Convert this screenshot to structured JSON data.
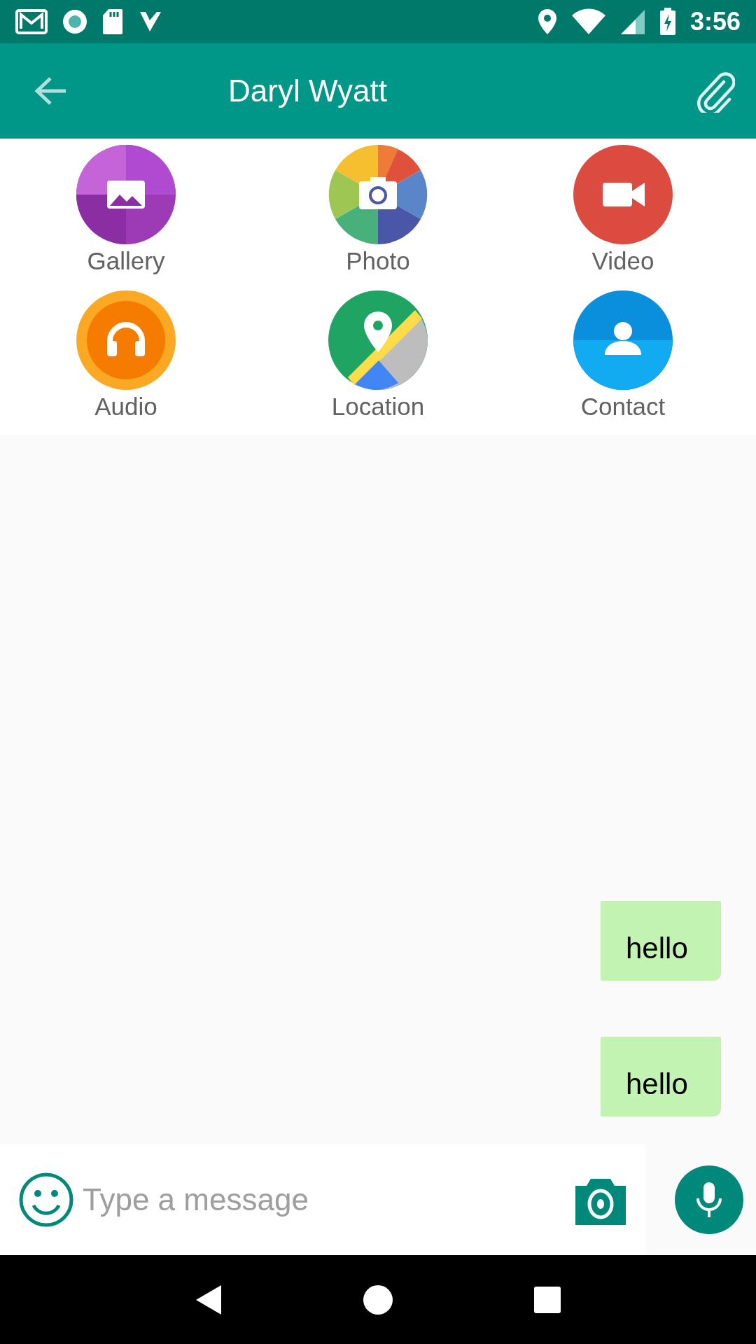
{
  "status_bar": {
    "time": "3:56"
  },
  "app_bar": {
    "title": "Daryl Wyatt"
  },
  "attachments": [
    {
      "label": "Gallery",
      "kind": "gallery"
    },
    {
      "label": "Photo",
      "kind": "photo"
    },
    {
      "label": "Video",
      "kind": "video"
    },
    {
      "label": "Audio",
      "kind": "audio"
    },
    {
      "label": "Location",
      "kind": "location"
    },
    {
      "label": "Contact",
      "kind": "contact"
    }
  ],
  "messages": [
    {
      "text": "hello",
      "outgoing": true
    },
    {
      "text": "hello",
      "outgoing": true
    }
  ],
  "composer": {
    "placeholder": "Type a message"
  }
}
